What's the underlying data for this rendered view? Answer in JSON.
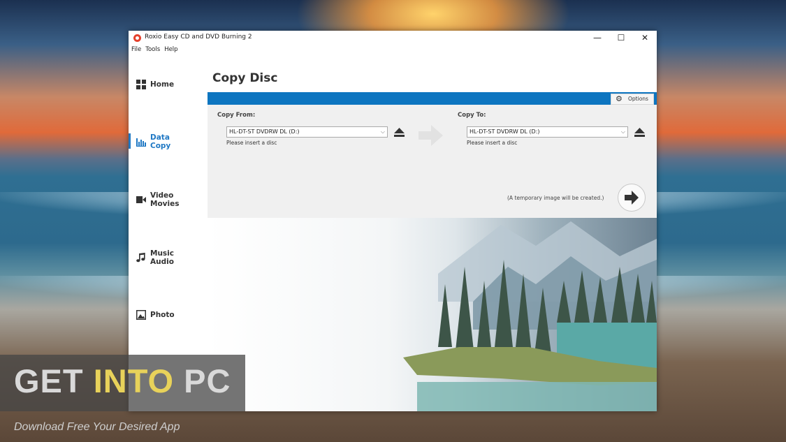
{
  "window": {
    "title": "Roxio Easy CD and DVD Burning 2",
    "controls": [
      "—",
      "☐",
      "✕"
    ]
  },
  "menu": [
    "File",
    "Tools",
    "Help"
  ],
  "sidebar": {
    "items": [
      {
        "label": "Home",
        "icon": "grid-icon"
      },
      {
        "label": "Data\nCopy",
        "icon": "bar-chart-icon",
        "active": true
      },
      {
        "label": "Video\nMovies",
        "icon": "video-camera-icon"
      },
      {
        "label": "Music\nAudio",
        "icon": "music-note-icon"
      },
      {
        "label": "Photo",
        "icon": "photo-icon"
      }
    ]
  },
  "main": {
    "heading": "Copy Disc",
    "options_label": "Options",
    "copy_from": {
      "label": "Copy From:",
      "drive": "HL-DT-ST DVDRW DL (D:)",
      "hint": "Please insert a disc"
    },
    "copy_to": {
      "label": "Copy To:",
      "drive": "HL-DT-ST DVDRW DL (D:)",
      "hint": "Please insert a disc"
    },
    "note": "(A temporary image will be created.)"
  },
  "watermark": {
    "title_part1": "GET ",
    "title_highlight": "INTO",
    "title_part2": " PC",
    "subtitle": "Download Free Your Desired App"
  },
  "colors": {
    "accent": "#0d75c0",
    "active_nav": "#1f78c4"
  }
}
